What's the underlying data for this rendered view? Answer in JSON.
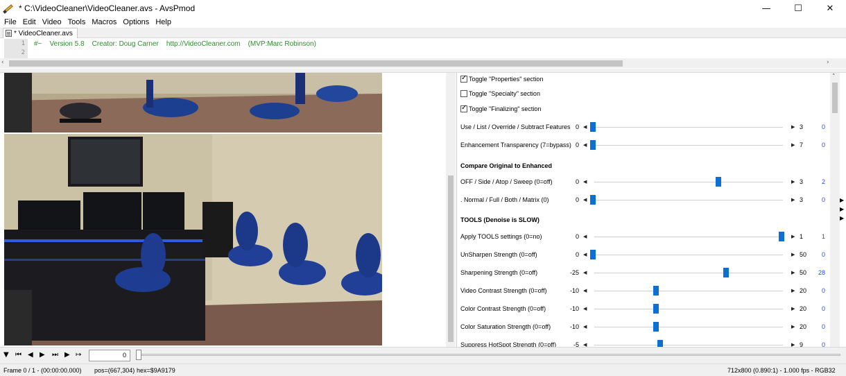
{
  "window": {
    "title": "* C:\\VideoCleaner\\VideoCleaner.avs - AvsPmod",
    "minimize": "—",
    "maximize": "☐",
    "close": "✕"
  },
  "menu": [
    "File",
    "Edit",
    "Video",
    "Tools",
    "Macros",
    "Options",
    "Help"
  ],
  "tab": {
    "label": "* VideoCleaner.avs"
  },
  "editor": {
    "line_numbers": [
      "1",
      "2"
    ],
    "code_line": "#~    Version 5.8    Creator: Doug Carner    http://VideoCleaner.com    (MVP:Marc Robinson)"
  },
  "panel": {
    "toggles": [
      {
        "label": "Toggle \"Properties\" section",
        "checked": true
      },
      {
        "label": "Toggle \"Specialty\" section",
        "checked": false
      },
      {
        "label": "Toggle \"Finalizing\" section",
        "checked": true
      }
    ],
    "sliders_a": [
      {
        "label": "Use / List / Override / Subtract Features",
        "min": "0",
        "max": "3",
        "value": "0",
        "fraction": 0.0
      },
      {
        "label": "Enhancement Transparency (7=bypass)",
        "min": "0",
        "max": "7",
        "value": "0",
        "fraction": 0.0
      }
    ],
    "section_compare": "Compare Original to Enhanced",
    "sliders_b": [
      {
        "label": "OFF / Side / Atop / Sweep (0=off)",
        "min": "0",
        "max": "3",
        "value": "2",
        "fraction": 0.667
      },
      {
        "label": ".    Normal / Full / Both / Matrix (0)",
        "min": "0",
        "max": "3",
        "value": "0",
        "fraction": 0.0
      }
    ],
    "section_tools": "TOOLS (Denoise is SLOW)",
    "sliders_c": [
      {
        "label": "Apply TOOLS settings (0=no)",
        "min": "0",
        "max": "1",
        "value": "1",
        "fraction": 1.0
      },
      {
        "label": "UnSharpen Strength (0=off)",
        "min": "0",
        "max": "50",
        "value": "0",
        "fraction": 0.0
      },
      {
        "label": "Sharpening Strength (0=off)",
        "min": "-25",
        "max": "50",
        "value": "28",
        "fraction": 0.707
      },
      {
        "label": "Video Contrast Strength (0=off)",
        "min": "-10",
        "max": "20",
        "value": "0",
        "fraction": 0.333
      },
      {
        "label": "Color Contrast Strength (0=off)",
        "min": "-10",
        "max": "20",
        "value": "0",
        "fraction": 0.333
      },
      {
        "label": "Color Saturation Strength (0=off)",
        "min": "-10",
        "max": "20",
        "value": "0",
        "fraction": 0.333
      },
      {
        "label": "Suppress HotSpot Strength (0=off)",
        "min": "-5",
        "max": "9",
        "value": "0",
        "fraction": 0.357
      }
    ]
  },
  "transport": {
    "frame_value": "0"
  },
  "status": {
    "frame": "Frame 0 / 1  -  (00:00:00.000)",
    "pos": "pos=(667,304)",
    "hex": "hex=$9A9179",
    "info": "712x800 (0.890:1)  -  1.000 fps  -  RGB32"
  },
  "colors": {
    "slider_knob": "#0c6fd1",
    "value_text": "#1f4ed6",
    "code_text": "#2e8b2e"
  }
}
